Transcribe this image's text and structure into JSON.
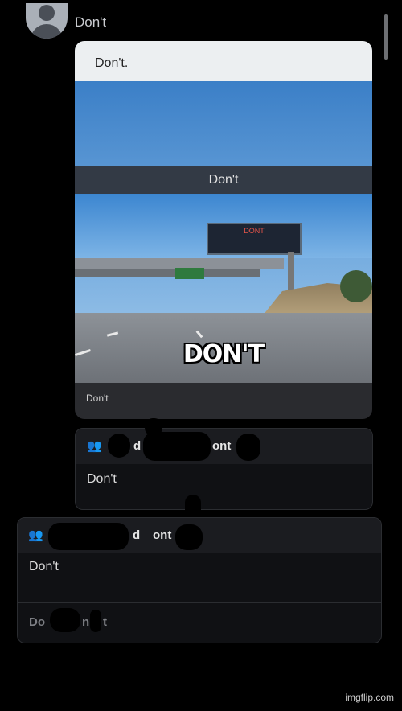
{
  "post": {
    "author": "Don't",
    "card_title": "Don't.",
    "image_caption": "Don't",
    "billboard_text": "DONT",
    "meme_text": "DON'T",
    "footer_text": "Don't"
  },
  "comment1": {
    "icon": "group-icon",
    "name_visible": "d",
    "name_visible_2": "ont",
    "body": "Don't"
  },
  "comment2": {
    "icon": "group-icon",
    "name_visible": "d",
    "name_visible_2": "ont",
    "body": "Don't",
    "footer_left": "Do",
    "footer_mid": "n",
    "footer_right": "t"
  },
  "watermark": "imgflip.com",
  "colors": {
    "background": "#000000",
    "card": "#2a2b2f",
    "accent": "#4a90e2"
  }
}
